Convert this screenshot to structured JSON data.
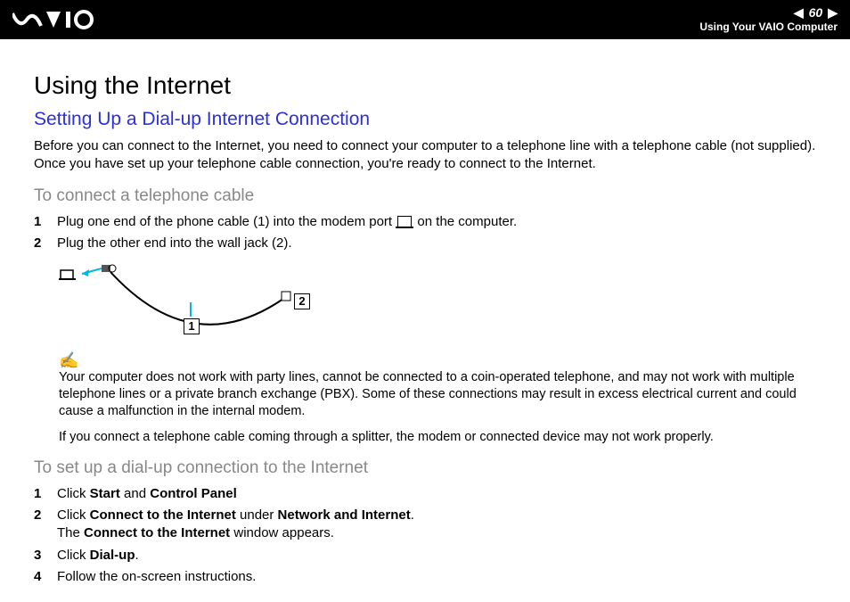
{
  "header": {
    "logo_text": "VAIO",
    "page_number": "60",
    "breadcrumb": "Using Your VAIO Computer"
  },
  "h1": "Using the Internet",
  "h2": "Setting Up a Dial-up Internet Connection",
  "intro": "Before you can connect to the Internet, you need to connect your computer to a telephone line with a telephone cable (not supplied). Once you have set up your telephone cable connection, you're ready to connect to the Internet.",
  "h3a": "To connect a telephone cable",
  "stepsA": [
    {
      "num": "1",
      "text_a": "Plug one end of the phone cable (1) into the modem port ",
      "text_b": " on the computer."
    },
    {
      "num": "2",
      "text": "Plug the other end into the wall jack (2)."
    }
  ],
  "diagram": {
    "callout1": "1",
    "callout2": "2"
  },
  "note1": "Your computer does not work with party lines, cannot be connected to a coin-operated telephone, and may not work with multiple telephone lines or a private branch exchange (PBX). Some of these connections may result in excess electrical current and could cause a malfunction in the internal modem.",
  "note2": "If you connect a telephone cable coming through a splitter, the modem or connected device may not work properly.",
  "h3b": "To set up a dial-up connection to the Internet",
  "stepsB": [
    {
      "num": "1",
      "pre": "Click ",
      "b1": "Start",
      "mid": " and ",
      "b2": "Control Panel"
    },
    {
      "num": "2",
      "pre": "Click ",
      "b1": "Connect to the Internet",
      "mid": " under ",
      "b2": "Network and Internet",
      "post": ".",
      "line2pre": "The ",
      "line2b": "Connect to the Internet",
      "line2post": " window appears."
    },
    {
      "num": "3",
      "pre": "Click ",
      "b1": "Dial-up",
      "post": "."
    },
    {
      "num": "4",
      "text": "Follow the on-screen instructions."
    }
  ]
}
